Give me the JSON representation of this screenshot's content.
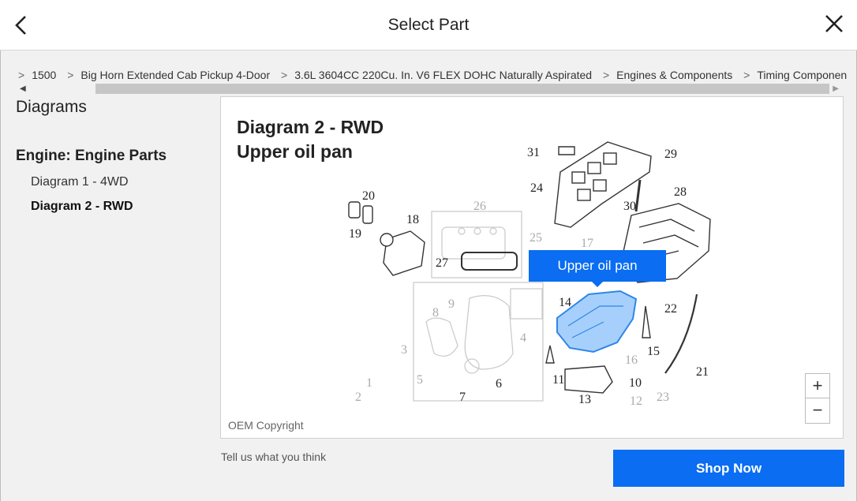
{
  "header": {
    "title": "Select Part"
  },
  "breadcrumbs": [
    {
      "sep": ">",
      "label": "1500"
    },
    {
      "sep": ">",
      "label": "Big Horn Extended Cab Pickup 4-Door"
    },
    {
      "sep": ">",
      "label": "3.6L 3604CC 220Cu. In. V6 FLEX DOHC Naturally Aspirated"
    },
    {
      "sep": ">",
      "label": "Engines & Components"
    },
    {
      "sep": ">",
      "label": "Timing Components"
    }
  ],
  "sidebar": {
    "heading": "Diagrams",
    "group": "Engine: Engine Parts",
    "items": [
      "Diagram 1 - 4WD",
      "Diagram 2 - RWD"
    ],
    "selected_index": 1
  },
  "diagram": {
    "title_line1": "Diagram 2 - RWD",
    "title_line2": "Upper oil pan",
    "tooltip": "Upper oil pan",
    "copyright": "OEM Copyright",
    "callouts": [
      "1",
      "2",
      "3",
      "4",
      "5",
      "6",
      "7",
      "8",
      "9",
      "10",
      "11",
      "12",
      "13",
      "14",
      "15",
      "16",
      "17",
      "18",
      "19",
      "20",
      "21",
      "22",
      "23",
      "24",
      "25",
      "26",
      "27",
      "28",
      "29",
      "30",
      "31"
    ],
    "highlight_color": "#4a9ff5",
    "tooltip_color": "#0a6df2"
  },
  "zoom": {
    "in": "+",
    "out": "−"
  },
  "footer": {
    "feedback": "Tell us what you think",
    "shop_button": "Shop Now"
  }
}
